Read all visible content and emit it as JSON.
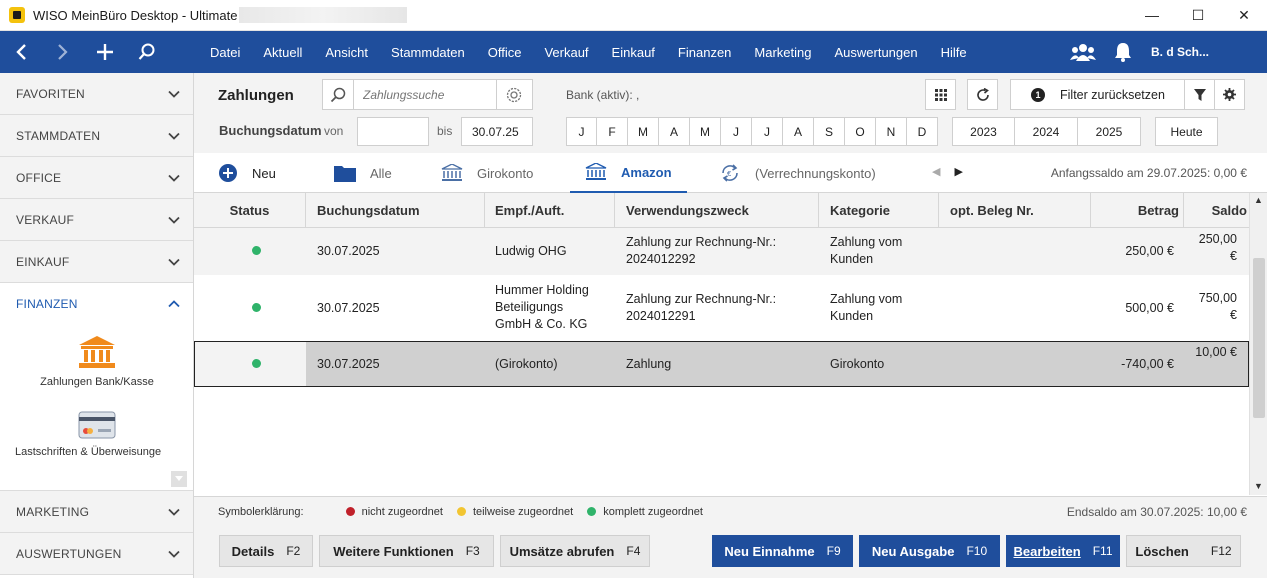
{
  "window": {
    "title": "WISO MeinBüro Desktop - Ultimate",
    "controls": {
      "minimize": "—",
      "maximize": "☐",
      "close": "✕"
    }
  },
  "topnav": {
    "menu": [
      "Datei",
      "Aktuell",
      "Ansicht",
      "Stammdaten",
      "Office",
      "Verkauf",
      "Einkauf",
      "Finanzen",
      "Marketing",
      "Auswertungen",
      "Hilfe"
    ],
    "user": "B. d Sch..."
  },
  "sidebar": {
    "items": [
      {
        "label": "FAVORITEN"
      },
      {
        "label": "STAMMDATEN"
      },
      {
        "label": "OFFICE"
      },
      {
        "label": "VERKAUF"
      },
      {
        "label": "EINKAUF"
      },
      {
        "label": "FINANZEN"
      },
      {
        "label": "MARKETING"
      },
      {
        "label": "AUSWERTUNGEN"
      }
    ],
    "tiles": [
      {
        "label": "Zahlungen Bank/Kasse"
      },
      {
        "label": "Lastschriften & Überweisunge"
      }
    ]
  },
  "header": {
    "title": "Zahlungen",
    "search_placeholder": "Zahlungssuche",
    "bank_label": "Bank (aktiv): ,",
    "filter_reset": {
      "count": "1",
      "label": "Filter zurücksetzen"
    },
    "booking_label": "Buchungsdatum",
    "from_label": "von",
    "from_value": "",
    "to_label": "bis",
    "to_value": "30.07.25",
    "months": [
      "J",
      "F",
      "M",
      "A",
      "M",
      "J",
      "J",
      "A",
      "S",
      "O",
      "N",
      "D"
    ],
    "years": [
      "2023",
      "2024",
      "2025"
    ],
    "today": "Heute"
  },
  "tabs": {
    "new_label": "Neu",
    "items": [
      {
        "label": "Alle"
      },
      {
        "label": "Girokonto"
      },
      {
        "label": "Amazon"
      },
      {
        "label": "(Verrechnungskonto)"
      }
    ],
    "active": "Amazon",
    "opening_balance": "Anfangssaldo am 29.07.2025: 0,00 €"
  },
  "table": {
    "columns": [
      "Status",
      "Buchungsdatum",
      "Empf./Auft.",
      "Verwendungszweck",
      "Kategorie",
      "opt. Beleg Nr.",
      "Betrag",
      "Saldo"
    ],
    "rows": [
      {
        "date": "30.07.2025",
        "payee_lines": [
          "Ludwig OHG"
        ],
        "purpose_lines": [
          "Zahlung zur Rechnung-Nr.:",
          "2024012292"
        ],
        "category_lines": [
          "Zahlung vom",
          "Kunden"
        ],
        "receipt": "",
        "amount": "250,00 €",
        "balance_lines": [
          "250,00",
          "€"
        ]
      },
      {
        "date": "30.07.2025",
        "payee_lines": [
          "Hummer Holding",
          "Beteiligungs",
          "GmbH & Co. KG"
        ],
        "purpose_lines": [
          "Zahlung zur Rechnung-Nr.:",
          "2024012291"
        ],
        "category_lines": [
          "Zahlung vom",
          "Kunden"
        ],
        "receipt": "",
        "amount": "500,00 €",
        "balance_lines": [
          "750,00",
          "€"
        ]
      },
      {
        "date": "30.07.2025",
        "payee_lines": [
          "(Girokonto)"
        ],
        "purpose_lines": [
          "Zahlung"
        ],
        "category_lines": [
          "Girokonto"
        ],
        "receipt": "",
        "amount": "-740,00 €",
        "balance_lines": [
          "10,00 €"
        ]
      }
    ]
  },
  "legend": {
    "label": "Symbolerklärung:",
    "items": [
      {
        "label": "nicht zugeordnet",
        "color": "#c0202a"
      },
      {
        "label": "teilweise zugeordnet",
        "color": "#f2c531"
      },
      {
        "label": "komplett zugeordnet",
        "color": "#2fb36a"
      }
    ],
    "closing_balance": "Endsaldo am 30.07.2025: 10,00 €"
  },
  "footer": {
    "buttons": [
      {
        "label": "Details",
        "key": "F2"
      },
      {
        "label": "Weitere Funktionen",
        "key": "F3"
      },
      {
        "label": "Umsätze abrufen",
        "key": "F4"
      },
      {
        "label": "Neu Einnahme",
        "key": "F9"
      },
      {
        "label": "Neu Ausgabe",
        "key": "F10"
      },
      {
        "label": "Bearbeiten",
        "key": "F11"
      },
      {
        "label": "Löschen",
        "key": "F12"
      }
    ]
  },
  "colors": {
    "brand": "#1f4e9c",
    "accent": "#1f5bb0",
    "status_ok": "#2fb36a"
  }
}
